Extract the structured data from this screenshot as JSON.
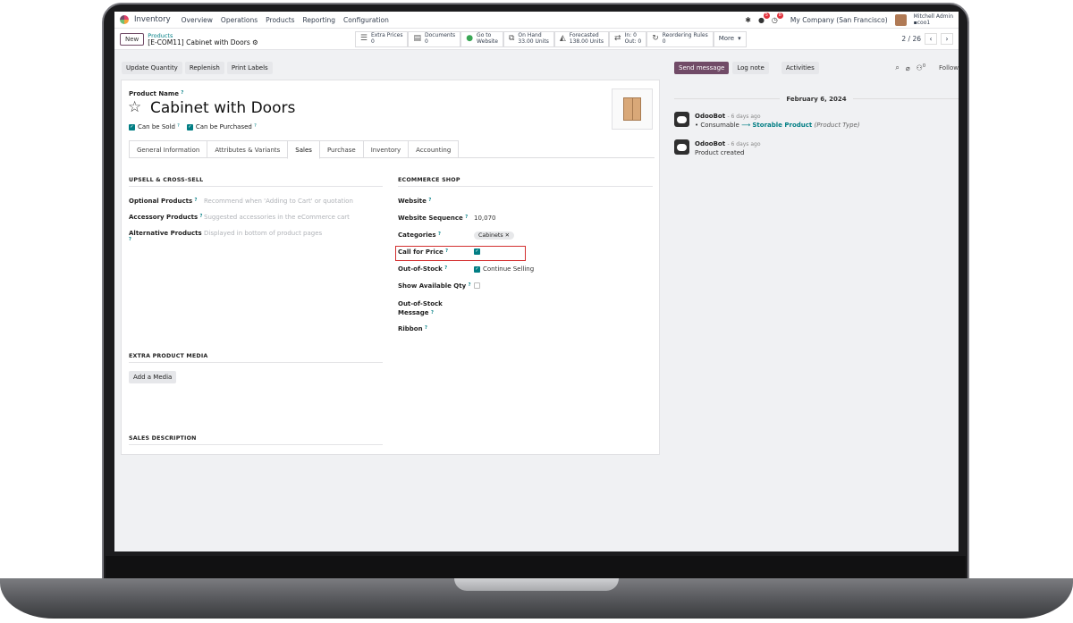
{
  "navbar": {
    "app_name": "Inventory",
    "menu": [
      "Overview",
      "Operations",
      "Products",
      "Reporting",
      "Configuration"
    ],
    "chat_badge": "5",
    "activity_badge": "8",
    "company": "My Company (San Francisco)",
    "user_name": "Mitchell Admin",
    "user_db": "coo1"
  },
  "control": {
    "new_label": "New",
    "breadcrumb_parent": "Products",
    "breadcrumb_current": "[E-COM11] Cabinet with Doors",
    "smart_buttons": [
      {
        "icon": "list-icon",
        "glyph": "☰",
        "line1": "Extra Prices",
        "line2": "0"
      },
      {
        "icon": "file-icon",
        "glyph": "▤",
        "line1": "Documents",
        "line2": "0"
      },
      {
        "icon": "globe-icon",
        "glyph": "●",
        "line1": "Go to",
        "line2": "Website"
      },
      {
        "icon": "cubes-icon",
        "glyph": "⧉",
        "line1": "On Hand",
        "line2": "33.00 Units"
      },
      {
        "icon": "chart-icon",
        "glyph": "◭",
        "line1": "Forecasted",
        "line2": "138.00 Units"
      },
      {
        "icon": "exchange-icon",
        "glyph": "⇄",
        "line1": "In: 0",
        "line2": "Out: 0"
      },
      {
        "icon": "refresh-icon",
        "glyph": "↻",
        "line1": "Reordering Rules",
        "line2": "0"
      }
    ],
    "more_label": "More",
    "pager": "2 / 26"
  },
  "actions": [
    "Update Quantity",
    "Replenish",
    "Print Labels"
  ],
  "product": {
    "name_label": "Product Name",
    "name": "Cabinet with Doors",
    "can_be_sold": "Can be Sold",
    "can_be_purchased": "Can be Purchased"
  },
  "tabs": [
    "General Information",
    "Attributes & Variants",
    "Sales",
    "Purchase",
    "Inventory",
    "Accounting"
  ],
  "upsell": {
    "title": "UPSELL & CROSS-SELL",
    "optional_label": "Optional Products",
    "optional_ph": "Recommend when 'Adding to Cart' or quotation",
    "accessory_label": "Accessory Products",
    "accessory_ph": "Suggested accessories in the eCommerce cart",
    "alternative_label": "Alternative Products",
    "alternative_ph": "Displayed in bottom of product pages"
  },
  "ecommerce": {
    "title": "ECOMMERCE SHOP",
    "website_label": "Website",
    "sequence_label": "Website Sequence",
    "sequence_value": "10,070",
    "categories_label": "Categories",
    "category_tag": "Cabinets",
    "call_for_price_label": "Call for Price",
    "out_of_stock_label": "Out-of-Stock",
    "continue_selling": "Continue Selling",
    "show_qty_label": "Show Available Qty",
    "oos_message_label_1": "Out-of-Stock",
    "oos_message_label_2": "Message",
    "ribbon_label": "Ribbon"
  },
  "media": {
    "title": "EXTRA PRODUCT MEDIA",
    "add_label": "Add a Media"
  },
  "description": {
    "title": "SALES DESCRIPTION"
  },
  "chatter": {
    "send_label": "Send message",
    "log_label": "Log note",
    "activities_label": "Activities",
    "follower_count": "0",
    "follow_label": "Follow",
    "date": "February 6, 2024",
    "messages": [
      {
        "author": "OdooBot",
        "ago": "- 6 days ago",
        "old": "Consumable",
        "new": "Storable Product",
        "field": "(Product Type)"
      },
      {
        "author": "OdooBot",
        "ago": "- 6 days ago",
        "text": "Product created"
      }
    ]
  },
  "colors": {
    "brand": "#714b67",
    "accent": "#017e84",
    "highlight": "#d32f2f"
  }
}
